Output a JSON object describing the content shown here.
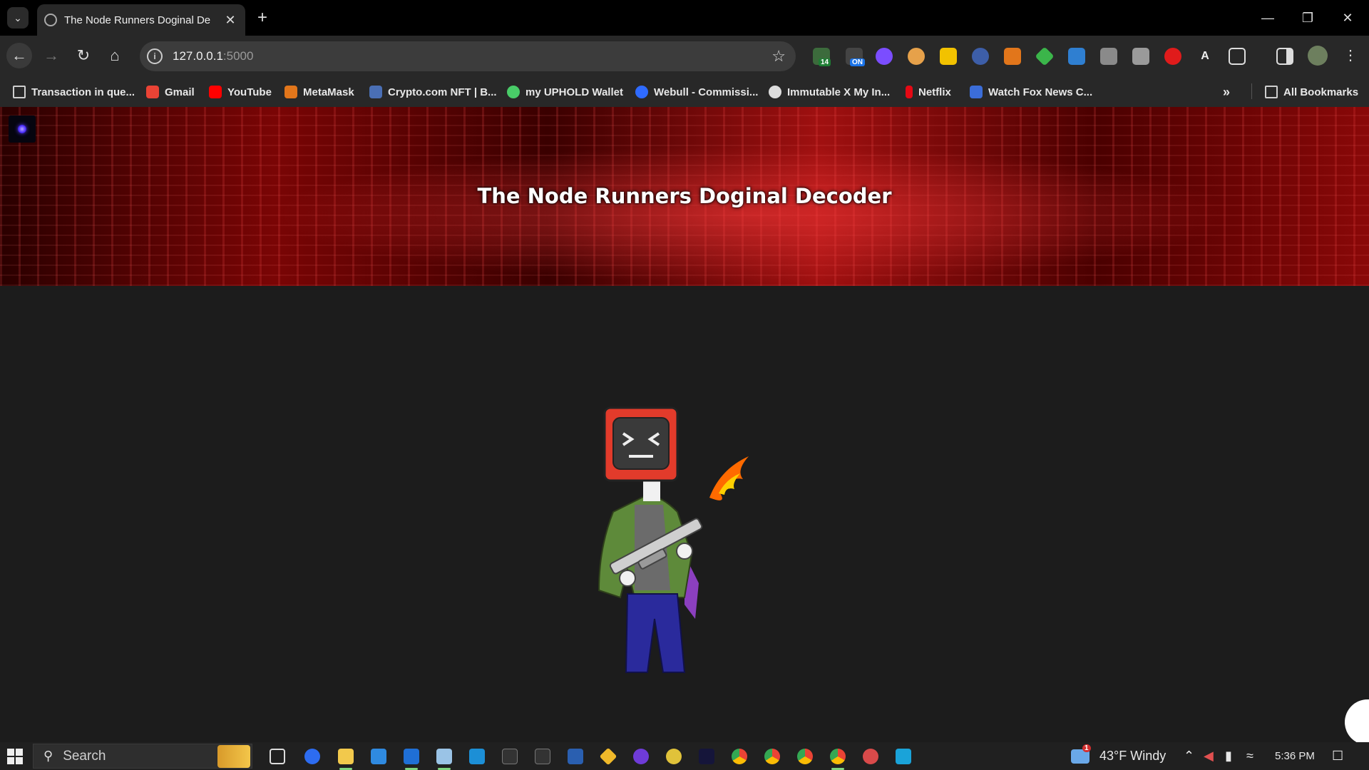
{
  "browser": {
    "tab_title": "The Node Runners Doginal De",
    "address": {
      "host": "127.0.0.1",
      "port": ":5000"
    },
    "extension_badges": {
      "ext1": "14",
      "ext2": "ON"
    }
  },
  "bookmarks": [
    {
      "label": "Transaction in que...",
      "icon": "folder-icon",
      "color": "#cfcfcf"
    },
    {
      "label": "Gmail",
      "icon": "gmail-icon",
      "color": "#ea4335"
    },
    {
      "label": "YouTube",
      "icon": "youtube-icon",
      "color": "#ff0000"
    },
    {
      "label": "MetaMask",
      "icon": "metamask-icon",
      "color": "#e2761b"
    },
    {
      "label": "Crypto.com NFT | B...",
      "icon": "cryptocom-icon",
      "color": "#4a6fb5"
    },
    {
      "label": "my UPHOLD Wallet",
      "icon": "uphold-icon",
      "color": "#49cc68"
    },
    {
      "label": "Webull - Commissi...",
      "icon": "webull-icon",
      "color": "#2f6bff"
    },
    {
      "label": "Immutable X My In...",
      "icon": "immutable-icon",
      "color": "#dddddd"
    },
    {
      "label": "Netflix",
      "icon": "netflix-icon",
      "color": "#e50914"
    },
    {
      "label": "Watch Fox News C...",
      "icon": "fox-icon",
      "color": "#3b6dd8"
    }
  ],
  "all_bookmarks": "All Bookmarks",
  "page": {
    "title": "The Node Runners Doginal Decoder"
  },
  "taskbar": {
    "search_placeholder": "Search",
    "weather": "43°F  Windy",
    "time": "5:36 PM",
    "weather_badge": "1"
  }
}
